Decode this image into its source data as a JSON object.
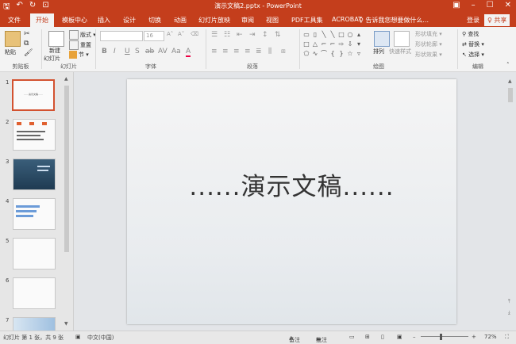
{
  "window": {
    "title": "演示文稿2.pptx - PowerPoint",
    "qat": {
      "save_icon": "save-icon",
      "undo_icon": "undo-icon",
      "redo_icon": "redo-icon",
      "start_icon": "from-beginning-icon"
    }
  },
  "tabs": [
    "文件",
    "开始",
    "模板中心",
    "插入",
    "设计",
    "切换",
    "动画",
    "幻灯片放映",
    "审阅",
    "视图",
    "PDF工具集",
    "ACROBAT"
  ],
  "active_tab": "开始",
  "tell_me": "♀ 告诉我您想要做什么...",
  "login": "登录",
  "share": "♀ 共享",
  "ribbon": {
    "clipboard": {
      "paste": "粘贴",
      "label": "剪贴板"
    },
    "slides": {
      "new": "新建",
      "new2": "幻灯片",
      "layout": "版式 ▾",
      "reset": "重置",
      "section": "节 ▾",
      "label": "幻灯片"
    },
    "font": {
      "size": "16",
      "label": "字体",
      "buttons": [
        "B",
        "I",
        "U",
        "S",
        "ab",
        "AV",
        "Aa",
        "A"
      ]
    },
    "paragraph": {
      "label": "段落"
    },
    "drawing": {
      "arrange": "排列",
      "quick_styles": "快速样式",
      "fill": "形状填充 ▾",
      "outline": "形状轮廓 ▾",
      "effects": "形状效果 ▾",
      "label": "绘图"
    },
    "editing": {
      "find": "查找",
      "replace": "替换 ▾",
      "select": "选择 ▾",
      "label": "编辑"
    }
  },
  "thumbnails": [
    {
      "num": "1",
      "caption": "......演示文稿......"
    },
    {
      "num": "2",
      "caption": ""
    },
    {
      "num": "3",
      "caption": ""
    },
    {
      "num": "4",
      "caption": ""
    },
    {
      "num": "5",
      "caption": ""
    },
    {
      "num": "6",
      "caption": ""
    },
    {
      "num": "7",
      "caption": ""
    }
  ],
  "slide": {
    "title": "......演示文稿......"
  },
  "status": {
    "slide_info": "幻灯片 第 1 张，共 9 张",
    "language": "中文(中国)",
    "notes": "备注",
    "comments": "批注",
    "zoom": "72%"
  },
  "colors": {
    "accent": "#c43e1c",
    "selected_thumb": "#d35230"
  }
}
